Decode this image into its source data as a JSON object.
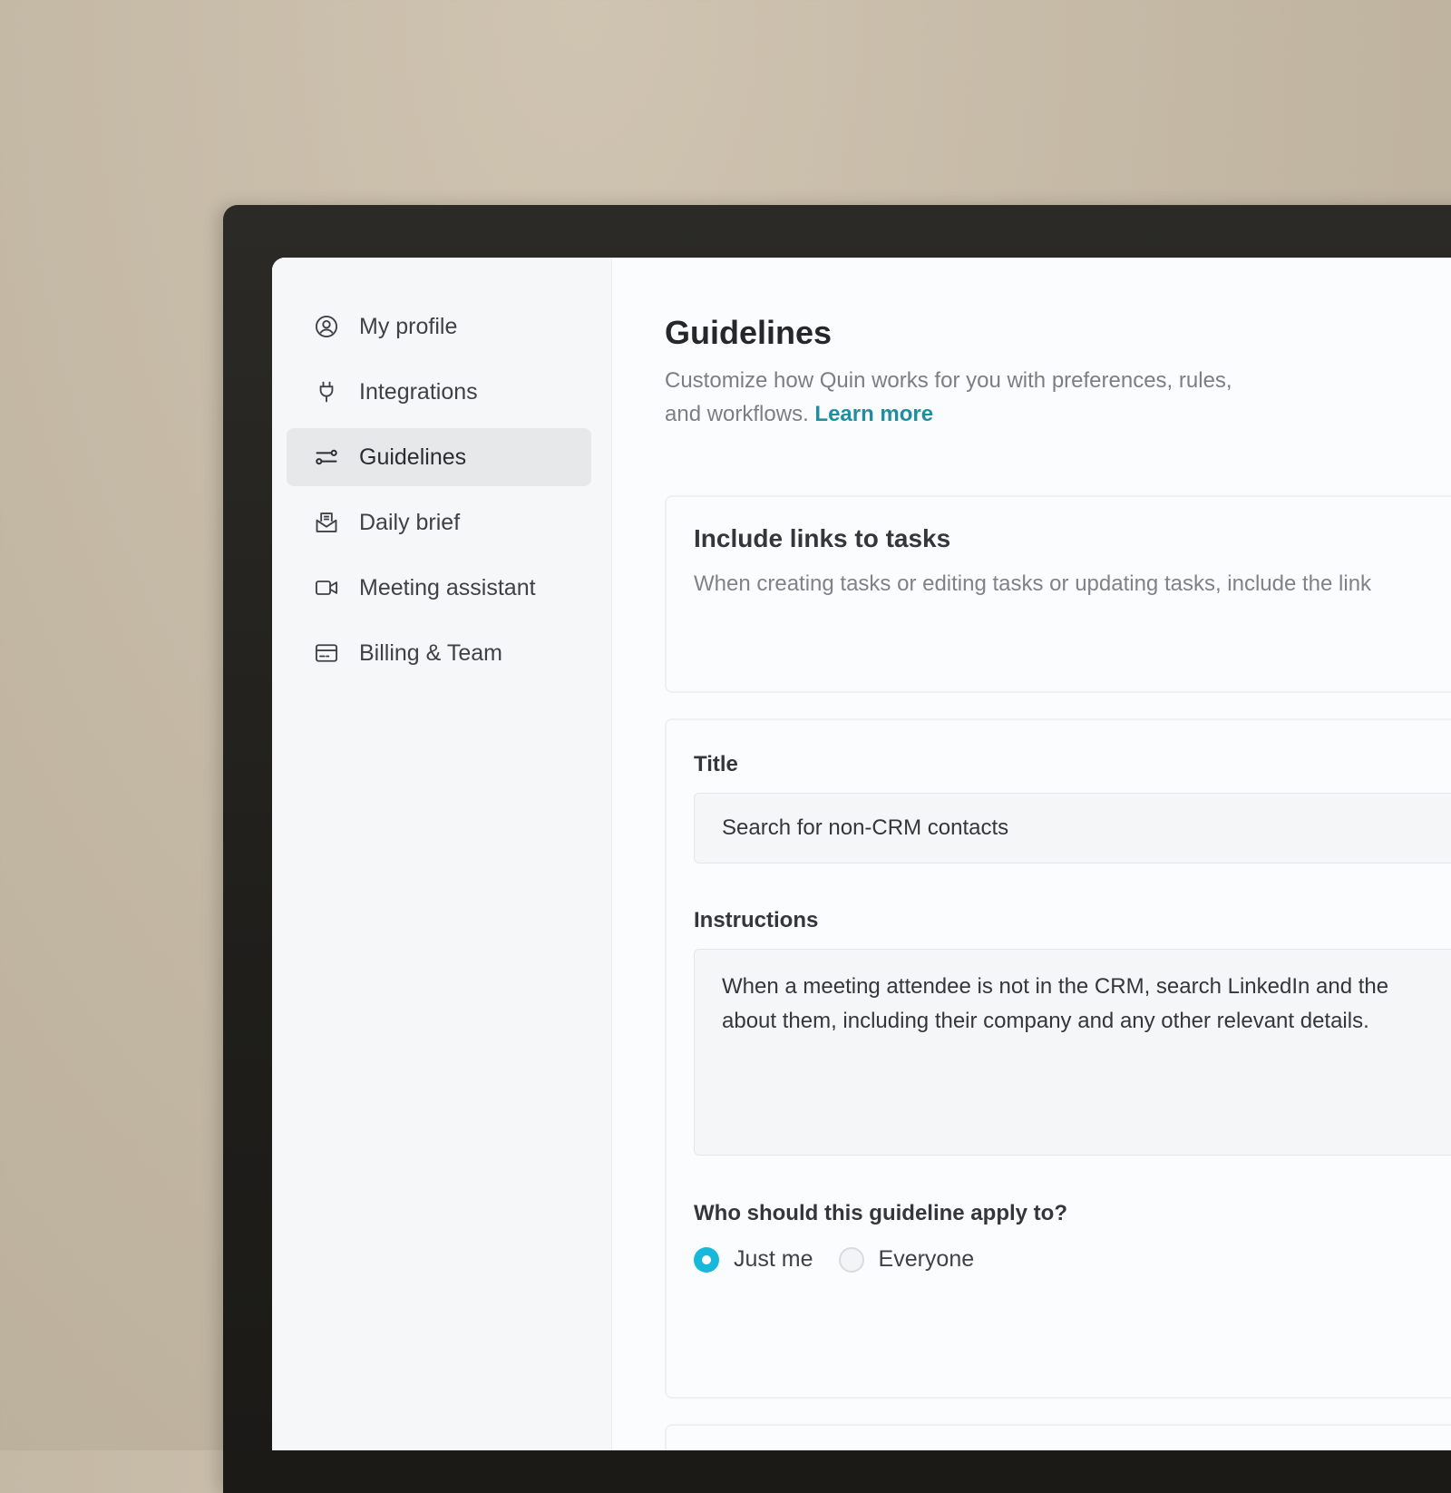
{
  "sidebar": {
    "items": [
      {
        "label": "My profile",
        "icon": "user-circle-icon"
      },
      {
        "label": "Integrations",
        "icon": "plug-icon"
      },
      {
        "label": "Guidelines",
        "icon": "sliders-icon",
        "active": true
      },
      {
        "label": "Daily brief",
        "icon": "inbox-document-icon"
      },
      {
        "label": "Meeting assistant",
        "icon": "video-camera-icon"
      },
      {
        "label": "Billing & Team",
        "icon": "credit-card-icon"
      }
    ]
  },
  "page": {
    "title": "Guidelines",
    "description": "Customize how Quin works for you with preferences, rules, and workflows.",
    "learn_more": "Learn more"
  },
  "guideline_card": {
    "title": "Include links to tasks",
    "description": "When creating tasks or editing tasks or updating tasks, include the link"
  },
  "edit_form": {
    "title_label": "Title",
    "title_value": "Search for non-CRM contacts",
    "instructions_label": "Instructions",
    "instructions_line1": "When a meeting attendee is not in the CRM, search LinkedIn and the",
    "instructions_line2": "about them, including their company and any other relevant details.",
    "apply_label": "Who should this guideline apply to?",
    "options": [
      {
        "label": "Just me",
        "selected": true
      },
      {
        "label": "Everyone",
        "selected": false
      }
    ]
  },
  "colors": {
    "accent": "#1f8fa0",
    "radio_selected": "#17b8da",
    "active_nav_bg": "#e6e8ea"
  }
}
